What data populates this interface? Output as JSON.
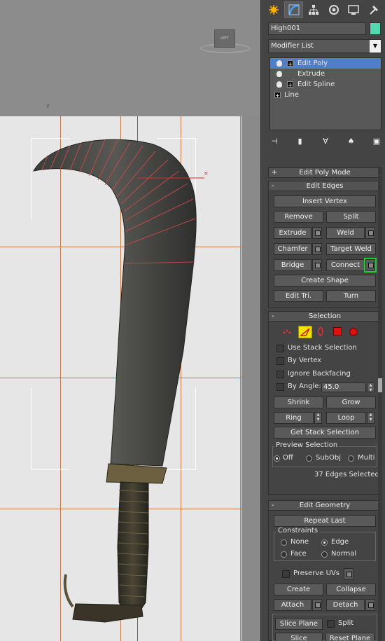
{
  "viewport": {
    "label": "LEFT",
    "axis_label": "y"
  },
  "panel": {
    "tabs": [
      "create-tab",
      "modify-tab",
      "hierarchy-tab",
      "motion-tab",
      "display-tab",
      "utilities-tab"
    ],
    "object_name": "High001",
    "object_color": "#55d8b0",
    "modifier_list": "Modifier List",
    "stack": [
      {
        "label": "Edit Poly",
        "selected": true
      },
      {
        "label": "Extrude",
        "selected": false
      },
      {
        "label": "Edit Spline",
        "selected": false
      },
      {
        "label": "Line",
        "selected": false
      }
    ],
    "stack_tools": [
      "pin-stack-icon",
      "show-end-result-icon",
      "make-unique-icon",
      "remove-modifier-icon",
      "configure-sets-icon"
    ]
  },
  "edit_poly_mode": {
    "title": "Edit Poly Mode",
    "sign": "+"
  },
  "edit_edges": {
    "title": "Edit Edges",
    "sign": "-",
    "insert_vertex": "Insert Vertex",
    "remove": "Remove",
    "split": "Split",
    "extrude": "Extrude",
    "weld": "Weld",
    "chamfer": "Chamfer",
    "target_weld": "Target Weld",
    "bridge": "Bridge",
    "connect": "Connect",
    "create_shape": "Create Shape",
    "edit_tri": "Edit Tri.",
    "turn": "Turn"
  },
  "selection": {
    "title": "Selection",
    "sign": "-",
    "use_stack_selection": "Use Stack Selection",
    "by_vertex": "By Vertex",
    "ignore_backfacing": "Ignore Backfacing",
    "by_angle": "By Angle:",
    "angle_value": "45.0",
    "shrink": "Shrink",
    "grow": "Grow",
    "ring": "Ring",
    "loop": "Loop",
    "get_stack_selection": "Get Stack Selection",
    "preview_selection": "Preview Selection",
    "preview_off": "Off",
    "preview_subobj": "SubObj",
    "preview_multi": "Multi",
    "status": "37 Edges Selected"
  },
  "edit_geometry": {
    "title": "Edit Geometry",
    "sign": "-",
    "repeat_last": "Repeat Last",
    "constraints": "Constraints",
    "none": "None",
    "edge": "Edge",
    "face": "Face",
    "normal": "Normal",
    "preserve_uvs": "Preserve UVs",
    "create": "Create",
    "collapse": "Collapse",
    "attach": "Attach",
    "detach": "Detach",
    "slice_plane": "Slice Plane",
    "split": "Split",
    "slice": "Slice",
    "reset_plane": "Reset Plane"
  },
  "colors": {
    "accent_selected": "#4f7fc9",
    "annotation_arrow": "#22cc33",
    "edge_highlight": "#e03030"
  }
}
